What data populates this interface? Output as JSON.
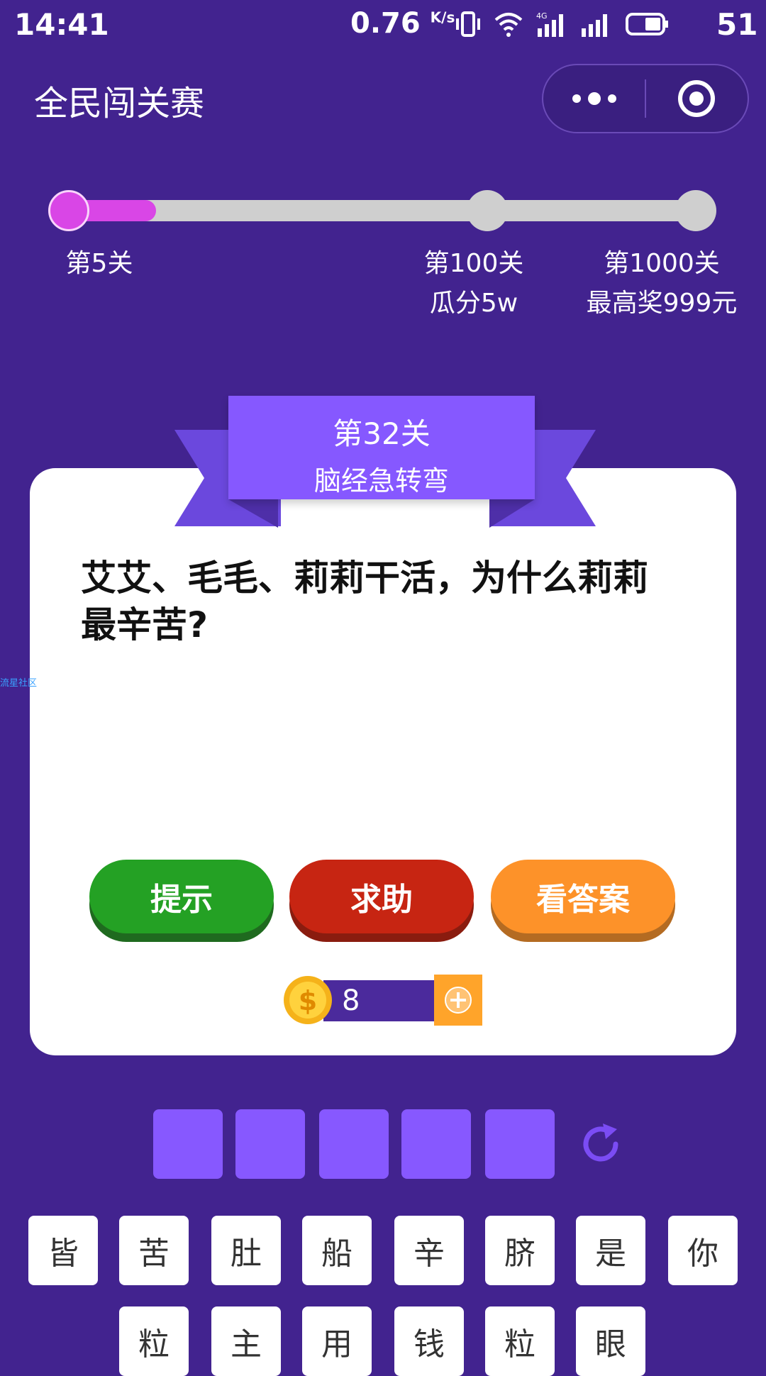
{
  "status_bar": {
    "time": "14:41",
    "speed": "0.76",
    "speed_unit": "K/s",
    "battery": "51"
  },
  "header": {
    "title": "全民闯关赛"
  },
  "progress": {
    "fraction": 0.16,
    "milestones": [
      {
        "label": "第5关",
        "sub": ""
      },
      {
        "label": "第100关",
        "sub": "瓜分5w"
      },
      {
        "label": "第1000关",
        "sub": "最高奖999元"
      }
    ]
  },
  "card": {
    "level": "第32关",
    "category": "脑经急转弯",
    "question": "艾艾、毛毛、莉莉干活，为什么莉莉最辛苦?",
    "watermark": "流星社区",
    "buttons": {
      "hint": "提示",
      "help": "求助",
      "answer": "看答案"
    },
    "coins": "8"
  },
  "answer_slots": 5,
  "keyboard": {
    "row1": [
      "皆",
      "苦",
      "肚",
      "船",
      "辛",
      "脐",
      "是",
      "你"
    ],
    "row2": [
      "粒",
      "主",
      "用",
      "钱",
      "粒",
      "眼"
    ]
  },
  "colors": {
    "background": "#42238f",
    "progress_fill": "#d946e6",
    "slot": "#8758ff",
    "hint": "#24a124",
    "help": "#c72512",
    "answer": "#fd9229"
  }
}
